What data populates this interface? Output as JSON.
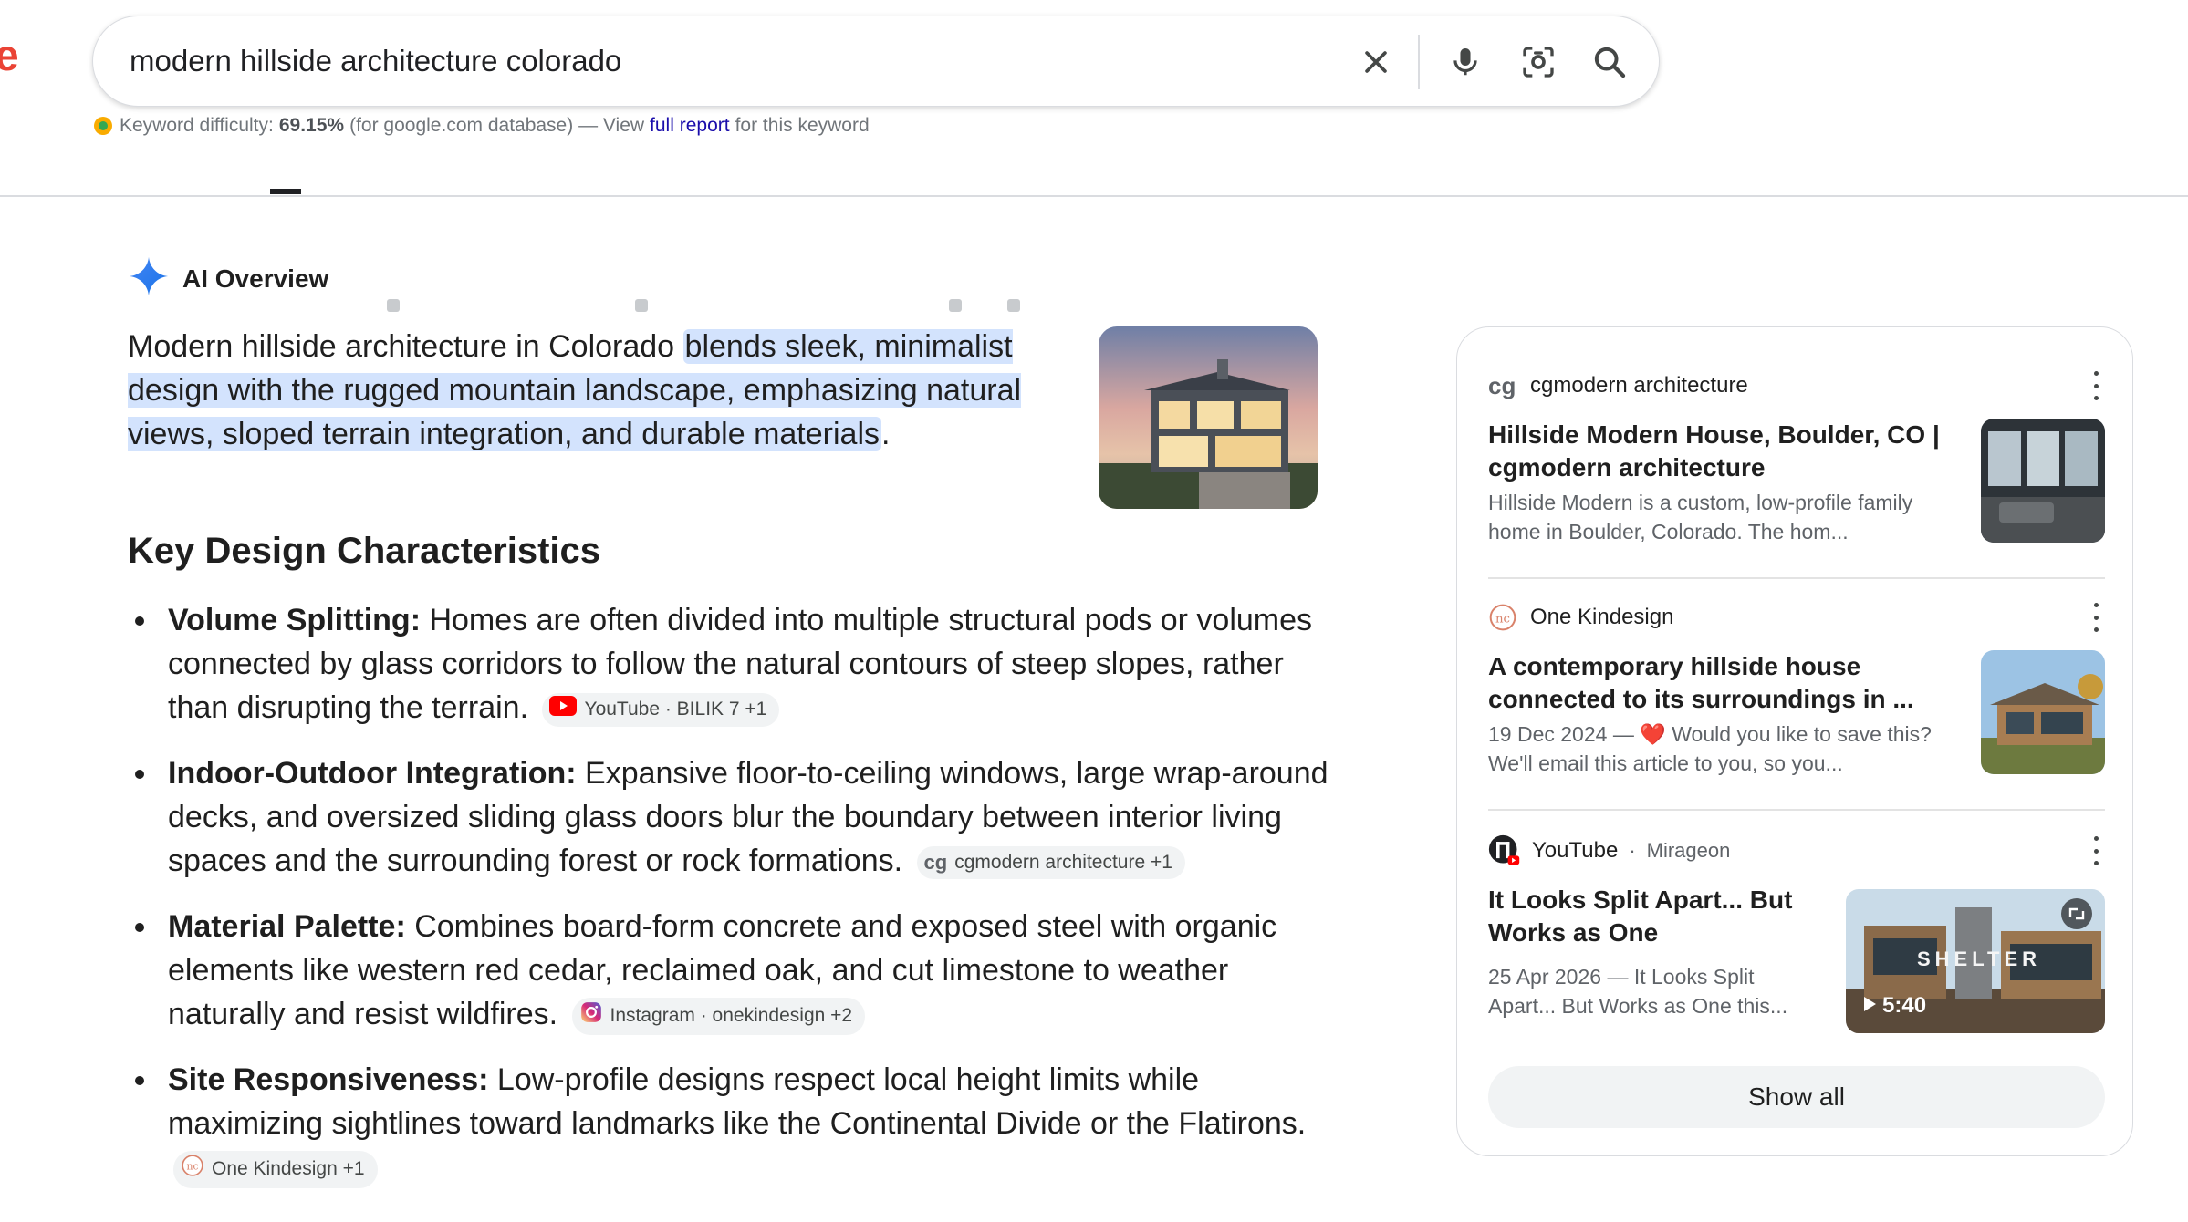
{
  "search": {
    "query": "modern hillside architecture colorado",
    "icons": [
      "clear-icon",
      "microphone-icon",
      "lens-icon",
      "search-icon"
    ]
  },
  "keyword": {
    "prefix": "Keyword difficulty:",
    "value": "69.15%",
    "database": "(for google.com database) — View",
    "link": "full report",
    "suffix": "for this keyword"
  },
  "ai_overview": {
    "title": "AI Overview",
    "summary_plain": "Modern hillside architecture in Colorado ",
    "summary_highlight": "blends sleek, minimalist design with the rugged mountain landscape, emphasizing natural views, sloped terrain integration, and durable materials",
    "summary_end": ".",
    "section_heading": "Key Design Characteristics",
    "bullets": [
      {
        "term": "Volume Splitting:",
        "text": " Homes are often divided into multiple structural pods or volumes connected by glass corridors to follow the natural contours of steep slopes, rather than disrupting the terrain.",
        "chip": "YouTube · BILIK 7 +1"
      },
      {
        "term": "Indoor-Outdoor Integration:",
        "text": " Expansive floor-to-ceiling windows, large wrap-around decks, and oversized sliding glass doors blur the boundary between interior living spaces and the surrounding forest or rock formations.",
        "chip": "cgmodern architecture +1"
      },
      {
        "term": "Material Palette:",
        "text": " Combines board-form concrete and exposed steel with organic elements like western red cedar, reclaimed oak, and cut limestone to weather naturally and resist wildfires.",
        "chip": "Instagram · onekindesign +2"
      },
      {
        "term": "Site Responsiveness:",
        "text": " Low-profile designs respect local height limits while maximizing sightlines toward landmarks like the Continental Divide or the Flatirons.",
        "chip": "One Kindesign +1"
      }
    ]
  },
  "sources": [
    {
      "site": "cgmodern architecture",
      "title": "Hillside Modern House, Boulder, CO | cgmodern architecture",
      "snippet": "Hillside Modern is a custom, low-profile family home in Boulder, Colorado. The hom..."
    },
    {
      "site": "One Kindesign",
      "title": "A contemporary hillside house connected to its surroundings in ...",
      "snippet": "19 Dec 2024 — ❤️ Would you like to save this? We'll email this article to you, so you..."
    },
    {
      "site": "YouTube",
      "channel": "Mirageon",
      "title": "It Looks Split Apart... But Works as One",
      "snippet": "25 Apr 2026 — It Looks Split Apart... But Works as One this...",
      "duration": "5:40",
      "overlay_text": "SHELTER"
    }
  ],
  "show_all": "Show all",
  "colors": {
    "highlight": "#d3e3fd",
    "link": "#1a0dab",
    "youtube_red": "#ff0000",
    "chip_bg": "#f1f3f4"
  }
}
